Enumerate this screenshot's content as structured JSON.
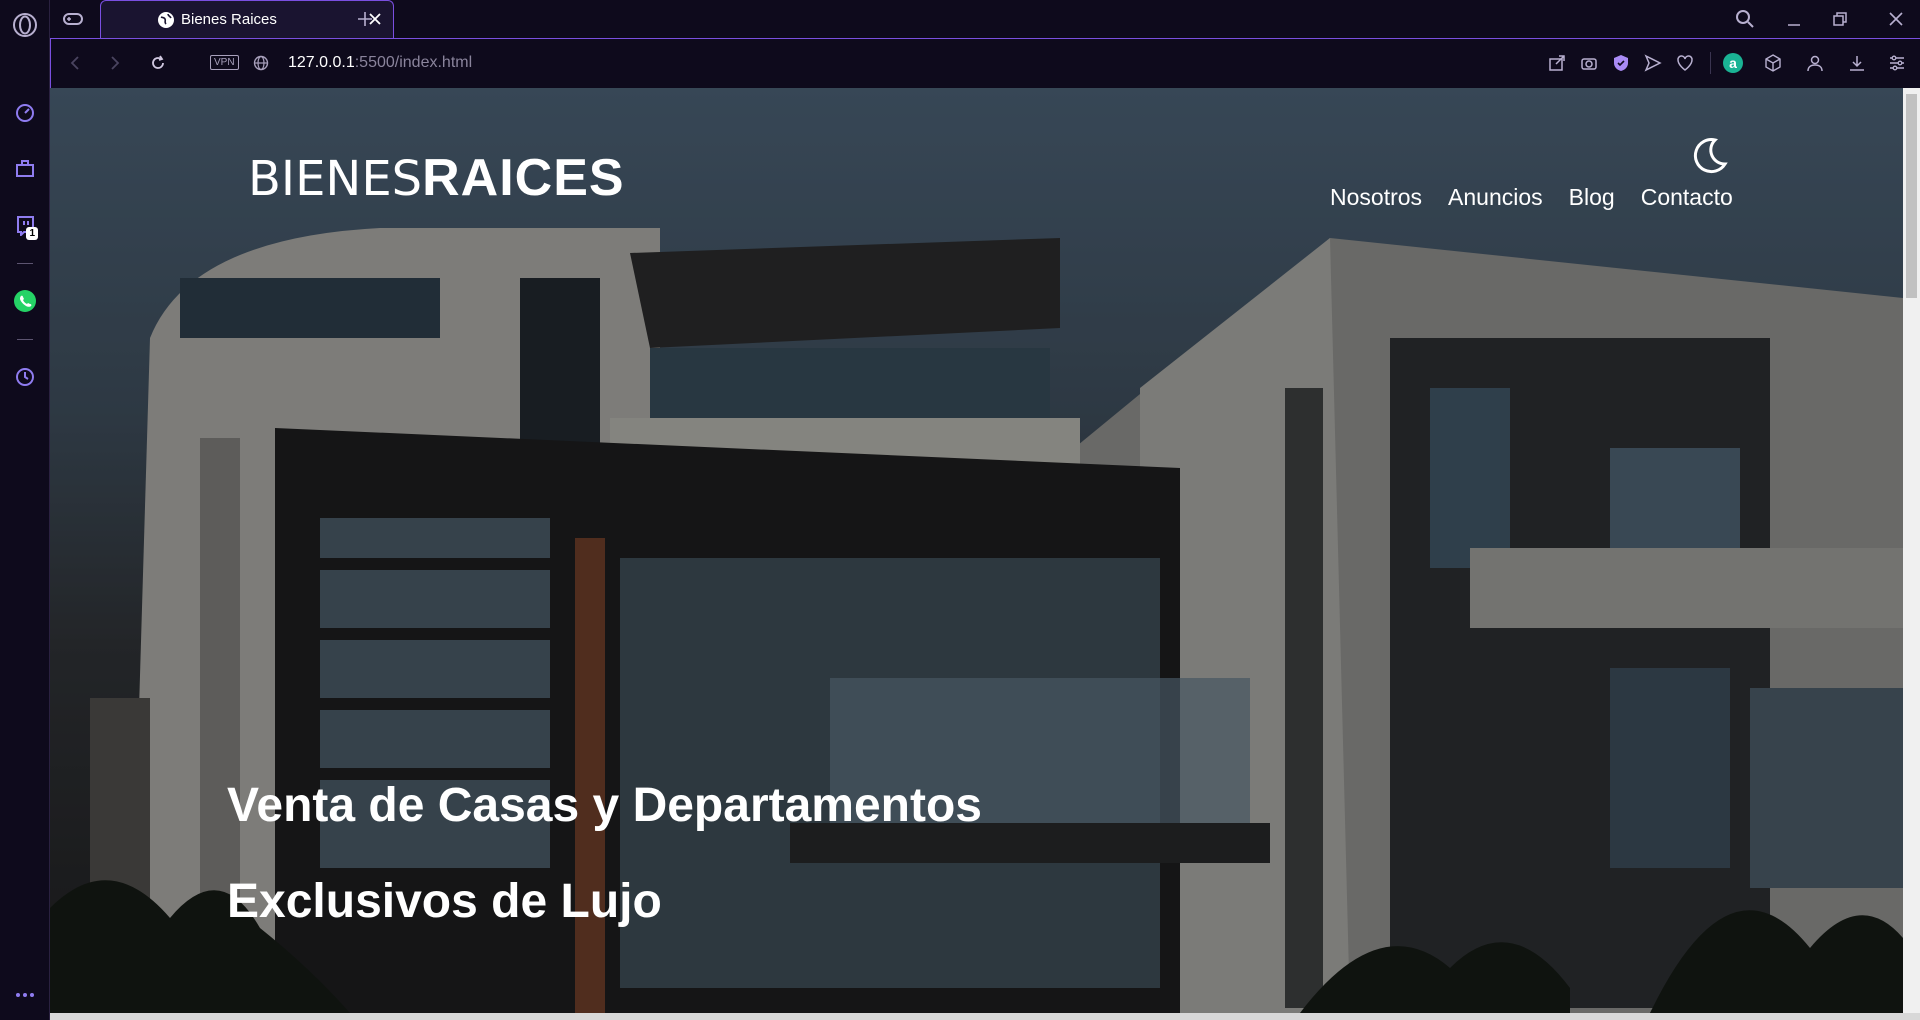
{
  "browser": {
    "tab_title": "Bienes Raices",
    "url_host": "127.0.0.1",
    "url_path": ":5500/index.html",
    "vpn_label": "VPN",
    "notification_count": "1",
    "accent_color": "#7a4fe0"
  },
  "site": {
    "logo_light": "BIENES",
    "logo_bold": "RAICES",
    "nav": [
      "Nosotros",
      "Anuncios",
      "Blog",
      "Contacto"
    ],
    "headline_1": "Venta de Casas y Departamentos",
    "headline_2": "Exclusivos de Lujo"
  }
}
